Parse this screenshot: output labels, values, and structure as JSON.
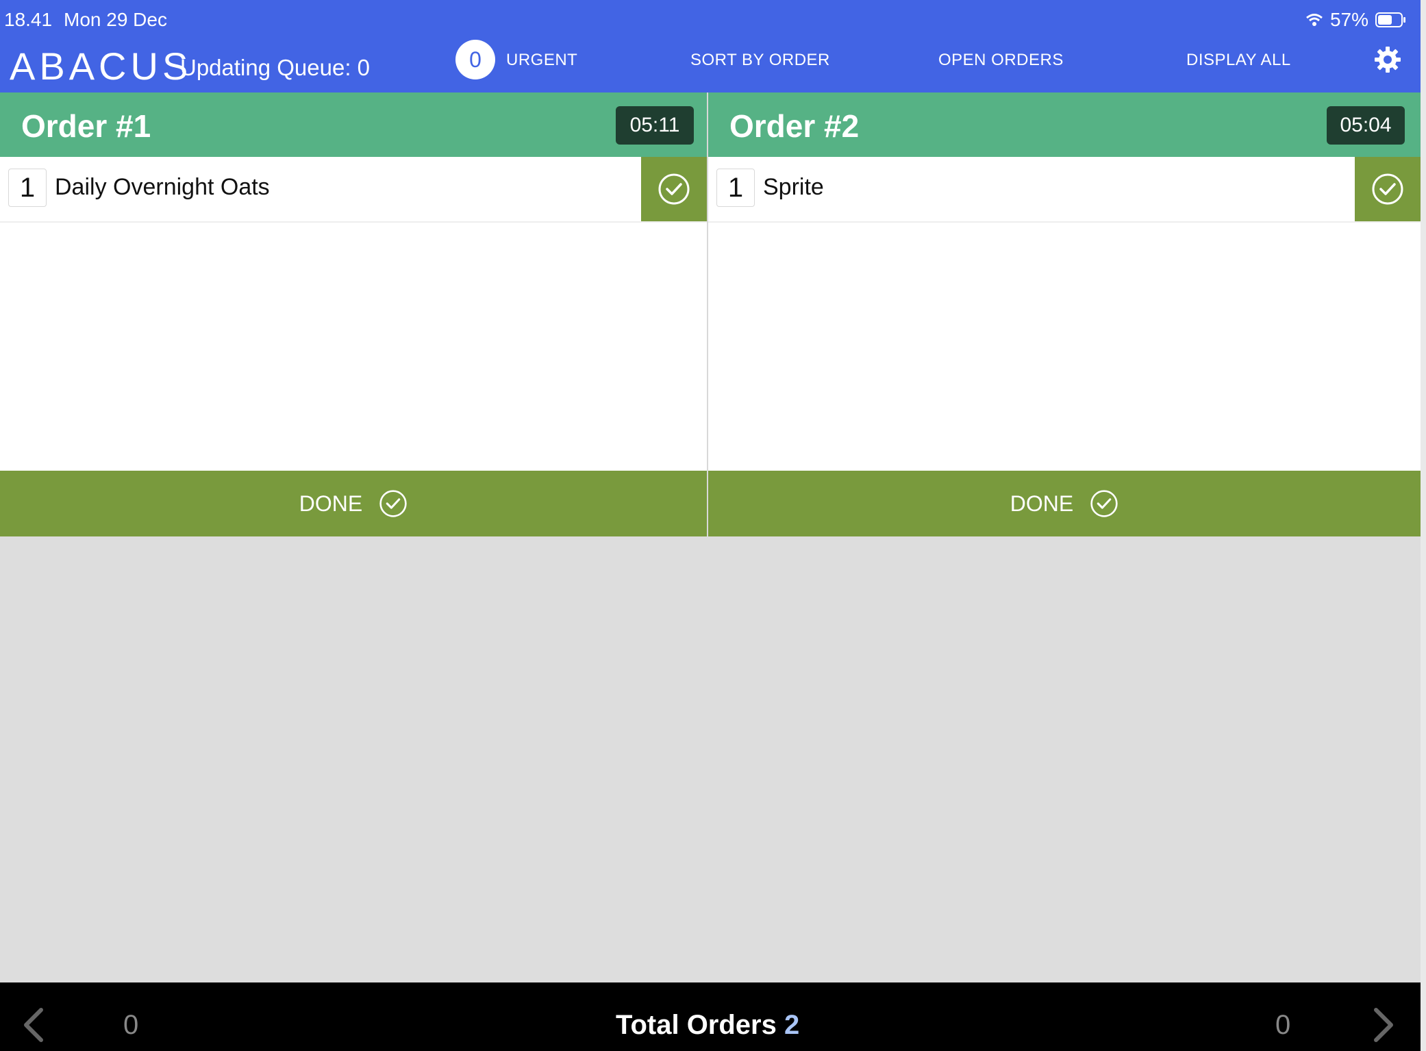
{
  "status_bar": {
    "time": "18.41",
    "date": "Mon 29 Dec",
    "battery": "57%"
  },
  "header": {
    "logo": "ABACUS",
    "queue": "Updating Queue: 0",
    "urgent_count": "0",
    "urgent_label": "URGENT",
    "sort_label": "SORT BY ORDER",
    "open_orders_label": "OPEN ORDERS",
    "display_all_label": "DISPLAY ALL",
    "settings_icon": "gear-icon"
  },
  "orders": [
    {
      "title": "Order #1",
      "timer": "05:11",
      "items": [
        {
          "qty": "1",
          "name": "Daily Overnight Oats"
        }
      ],
      "done_label": "DONE"
    },
    {
      "title": "Order #2",
      "timer": "05:04",
      "items": [
        {
          "qty": "1",
          "name": "Sprite"
        }
      ],
      "done_label": "DONE"
    }
  ],
  "footer": {
    "left_count": "0",
    "total_label": "Total Orders",
    "total_value": "2",
    "right_count": "0"
  },
  "colors": {
    "header_bg": "#4264e4",
    "order_header": "#56b285",
    "done_green": "#799a3d",
    "timer_bg": "#1f3e30",
    "footer_bg": "#000000"
  }
}
